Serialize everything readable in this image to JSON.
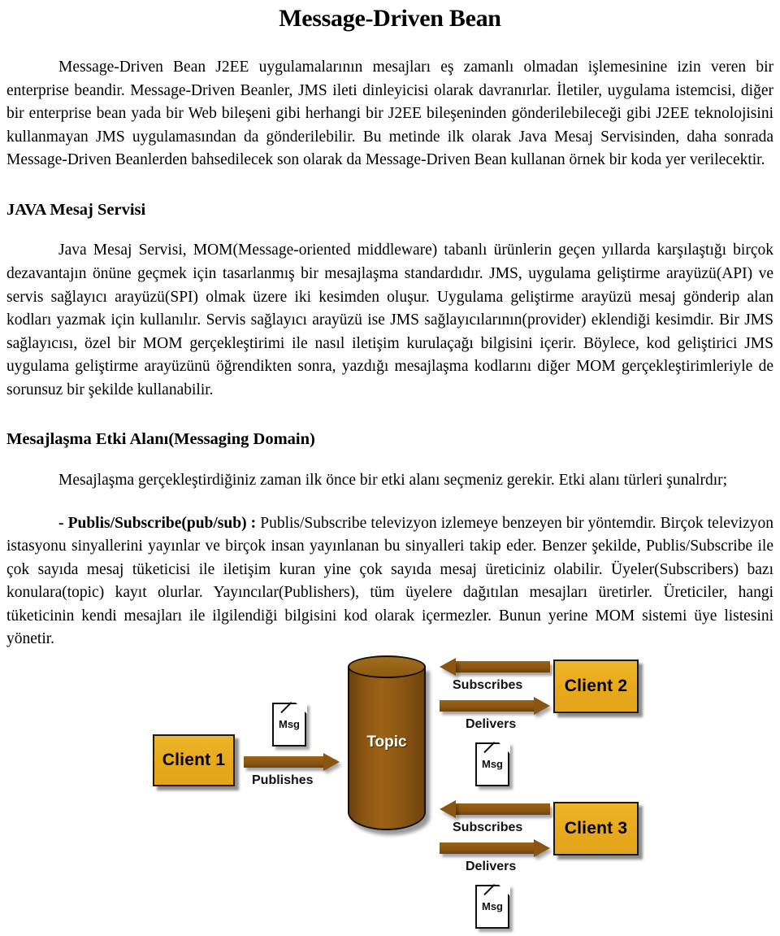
{
  "document": {
    "title": "Message-Driven Bean",
    "paragraphs": {
      "intro": "Message-Driven Bean J2EE uygulamalarının mesajları eş zamanlı olmadan işlemesinine izin veren bir enterprise beandir. Message-Driven Beanler, JMS ileti dinleyicisi olarak davranırlar. İletiler, uygulama istemcisi, diğer bir enterprise bean yada bir Web bileşeni gibi  herhangi bir J2EE bileşeninden gönderilebileceği gibi J2EE teknolojisini kullanmayan JMS uygulamasından da gönderilebilir.  Bu metinde ilk olarak Java Mesaj Servisinden, daha sonrada Message-Driven Beanlerden bahsedilecek son olarak da Message-Driven Bean kullanan örnek bir koda yer verilecektir.",
      "jms_body": "Java Mesaj Servisi, MOM(Message-oriented middleware) tabanlı ürünlerin geçen yıllarda karşılaştığı birçok dezavantajın önüne geçmek için tasarlanmış bir mesajlaşma standardıdır.  JMS, uygulama geliştirme arayüzü(API) ve servis sağlayıcı arayüzü(SPI) olmak üzere iki kesimden oluşur. Uygulama geliştirme arayüzü mesaj gönderip alan kodları yazmak için kullanılır. Servis sağlayıcı arayüzü ise JMS sağlayıcılarının(provider) eklendiği kesimdir. Bir JMS sağlayıcısı,  özel bir MOM gerçekleştirimi ile nasıl iletişim kurulaçağı bilgisini içerir. Böylece, kod geliştirici  JMS uygulama geliştirme arayüzünü öğrendikten sonra, yazdığı mesajlaşma kodlarını diğer MOM gerçekleştirimleriyle de sorunsuz bir şekilde kullanabilir.",
      "domain_body": "Mesajlaşma gerçekleştirdiğiniz zaman ilk önce bir etki alanı seçmeniz gerekir. Etki alanı türleri şunalrdır;",
      "pubsub_label": "- Publis/Subscribe(pub/sub) :",
      "pubsub_body": " Publis/Subscribe televizyon izlemeye benzeyen bir yöntemdir. Birçok televizyon istasyonu sinyallerini yayınlar ve birçok insan yayınlanan bu sinyalleri takip eder. Benzer şekilde, Publis/Subscribe ile çok sayıda mesaj tüketicisi ile iletişim kuran  yine çok sayıda mesaj üreticiniz olabilir. Üyeler(Subscribers) bazı konulara(topic) kayıt olurlar. Yayıncılar(Publishers), tüm üyelere dağıtılan mesajları üretirler. Üreticiler, hangi tüketicinin kendi mesajları ile ilgilendiği bilgisini kod olarak içermezler. Bunun yerine MOM sistemi üye listesini yönetir."
    },
    "headings": {
      "jms": "JAVA Mesaj Servisi",
      "messaging_domain": "Mesajlaşma Etki Alanı(Messaging Domain)"
    }
  },
  "diagram": {
    "nodes": {
      "client1": "Client 1",
      "client2": "Client 2",
      "client3": "Client 3",
      "topic": "Topic"
    },
    "messages": {
      "msg1": "Msg",
      "msg2": "Msg",
      "msg3": "Msg"
    },
    "edges": {
      "publishes": "Publishes",
      "subscribes_top": "Subscribes",
      "delivers_top": "Delivers",
      "subscribes_bottom": "Subscribes",
      "delivers_bottom": "Delivers"
    },
    "colors": {
      "client_fill": "#e8a81c",
      "topic_fill": "#8a5512",
      "arrow_fill": "#8a5512",
      "outline": "#111111",
      "msg_fill": "#ffffff"
    }
  }
}
